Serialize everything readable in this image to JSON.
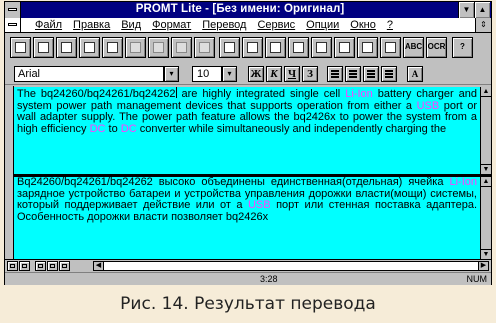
{
  "window": {
    "title": "PROMT Lite - [Без имени: Оригинал]",
    "minimize_glyph": "▼",
    "maximize_glyph": "▲",
    "restore_glyph": "⇕"
  },
  "menu": {
    "items": [
      "Файл",
      "Правка",
      "Вид",
      "Формат",
      "Перевод",
      "Сервис",
      "Опции",
      "Окно",
      "?"
    ]
  },
  "toolbar": {
    "buttons": [
      {
        "icon": "new-document-icon"
      },
      {
        "icon": "open-folder-icon"
      },
      {
        "icon": "save-disk-icon"
      },
      {
        "icon": "dictionary-book-icon"
      },
      {
        "icon": "find-magnifier-icon"
      },
      {
        "icon": "translate-document-icon"
      },
      {
        "icon": "translate-paragraph-icon"
      },
      {
        "icon": "translate-page-icon"
      },
      {
        "icon": "translate-selection-icon"
      },
      {
        "icon": "split-horizontal-icon"
      },
      {
        "icon": "split-vertical-icon"
      },
      {
        "icon": "copy-document-icon"
      },
      {
        "icon": "paste-document-icon"
      },
      {
        "icon": "cancel-translation-icon"
      },
      {
        "icon": "search-document-icon"
      },
      {
        "icon": "view-translation-icon"
      },
      {
        "icon": "alert-indicator-icon"
      },
      {
        "icon": "spellcheck-icon",
        "label": "ABC"
      },
      {
        "icon": "ocr-icon",
        "label": "OCR"
      },
      {
        "icon": "help-question-icon",
        "label": "?"
      }
    ]
  },
  "format": {
    "font": "Arial",
    "size": "10",
    "bold": "Ж",
    "italic": "К",
    "underline": "Ч",
    "strike": "З",
    "dropdown_glyph": "▾"
  },
  "source_text": {
    "segments": [
      {
        "t": "The bq24260/bq24261/bq24262",
        "hl": false
      },
      {
        "t": "CARET",
        "hl": false
      },
      {
        "t": " are highly integrated single cell ",
        "hl": false
      },
      {
        "t": "Li-Ion",
        "hl": true
      },
      {
        "t": " battery charger and system power path management devices that supports operation from either a ",
        "hl": false
      },
      {
        "t": "USB",
        "hl": true
      },
      {
        "t": " port or wall adapter supply. The power path feature allows the bq2426x to power the system from a high efficiency ",
        "hl": false
      },
      {
        "t": "DC",
        "hl": true
      },
      {
        "t": " to ",
        "hl": false
      },
      {
        "t": "DC",
        "hl": true
      },
      {
        "t": " converter while simultaneously and independently charging the",
        "hl": false
      }
    ]
  },
  "target_text": {
    "segments": [
      {
        "t": "Bq24260/bq24261/bq24262 высоко объединены единственная(отдельная) ячейка ",
        "hl": false
      },
      {
        "t": "Li-Ion",
        "hl": true
      },
      {
        "t": " зарядное устройство батареи и устройства управления дорожки власти(мощи) системы, который поддерживает действие или от a ",
        "hl": false
      },
      {
        "t": "USB",
        "hl": true
      },
      {
        "t": " порт или стенная поставка адаптера. Особенность дорожки власти позволяет bq2426x",
        "hl": false
      }
    ]
  },
  "statusbar": {
    "time": "3:28",
    "mode": "NUM"
  },
  "caption": "Рис. 14. Результат перевода"
}
